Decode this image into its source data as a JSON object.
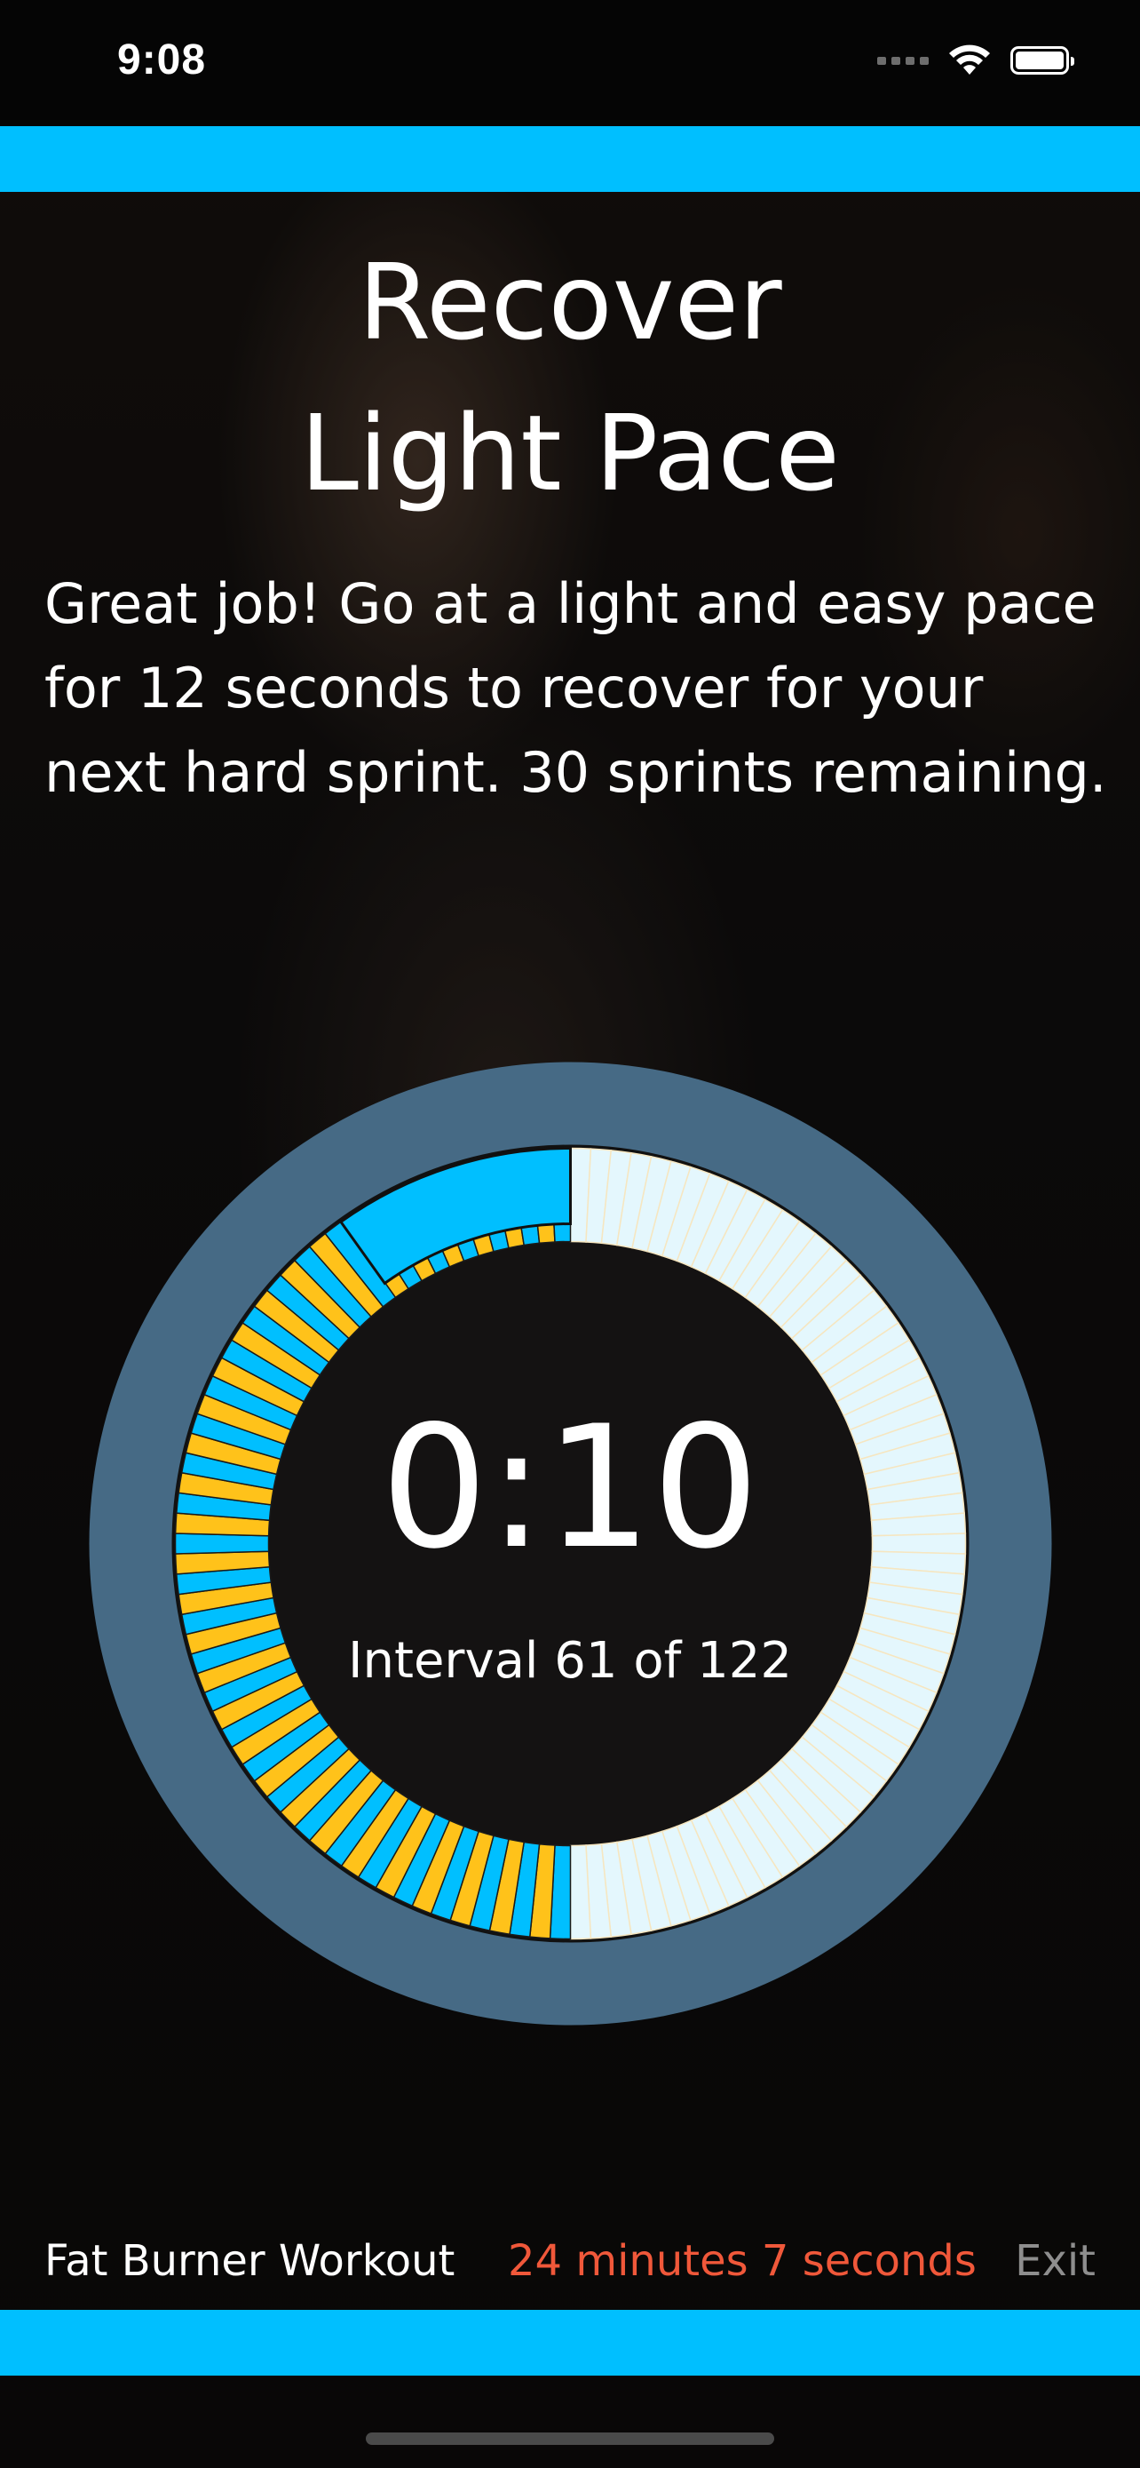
{
  "status_bar": {
    "time": "9:08",
    "icons": [
      "cellular-signal-icon",
      "wifi-icon",
      "battery-icon"
    ]
  },
  "colors": {
    "accent": "#00bfff",
    "ring_bg": "#466a85",
    "sprint_segment": "#ffc21a",
    "recover_segment": "#00bfff",
    "completed_segment": "#e4f7fd",
    "remaining_time": "#f0583a"
  },
  "instruction": {
    "title_line1": "Recover",
    "title_line2": "Light Pace",
    "message_line1": "Great job! Go at a light and easy pace",
    "message_line2": "for 12 seconds to recover for your",
    "message_line3": "next hard sprint. 30 sprints remaining."
  },
  "timer": {
    "countdown": "0:10",
    "interval_text": "Interval 61 of 122",
    "current_interval": 61,
    "total_intervals": 122
  },
  "footer": {
    "workout_name": "Fat Burner Workout",
    "time_remaining": "24 minutes 7 seconds",
    "exit_label": "Exit"
  }
}
